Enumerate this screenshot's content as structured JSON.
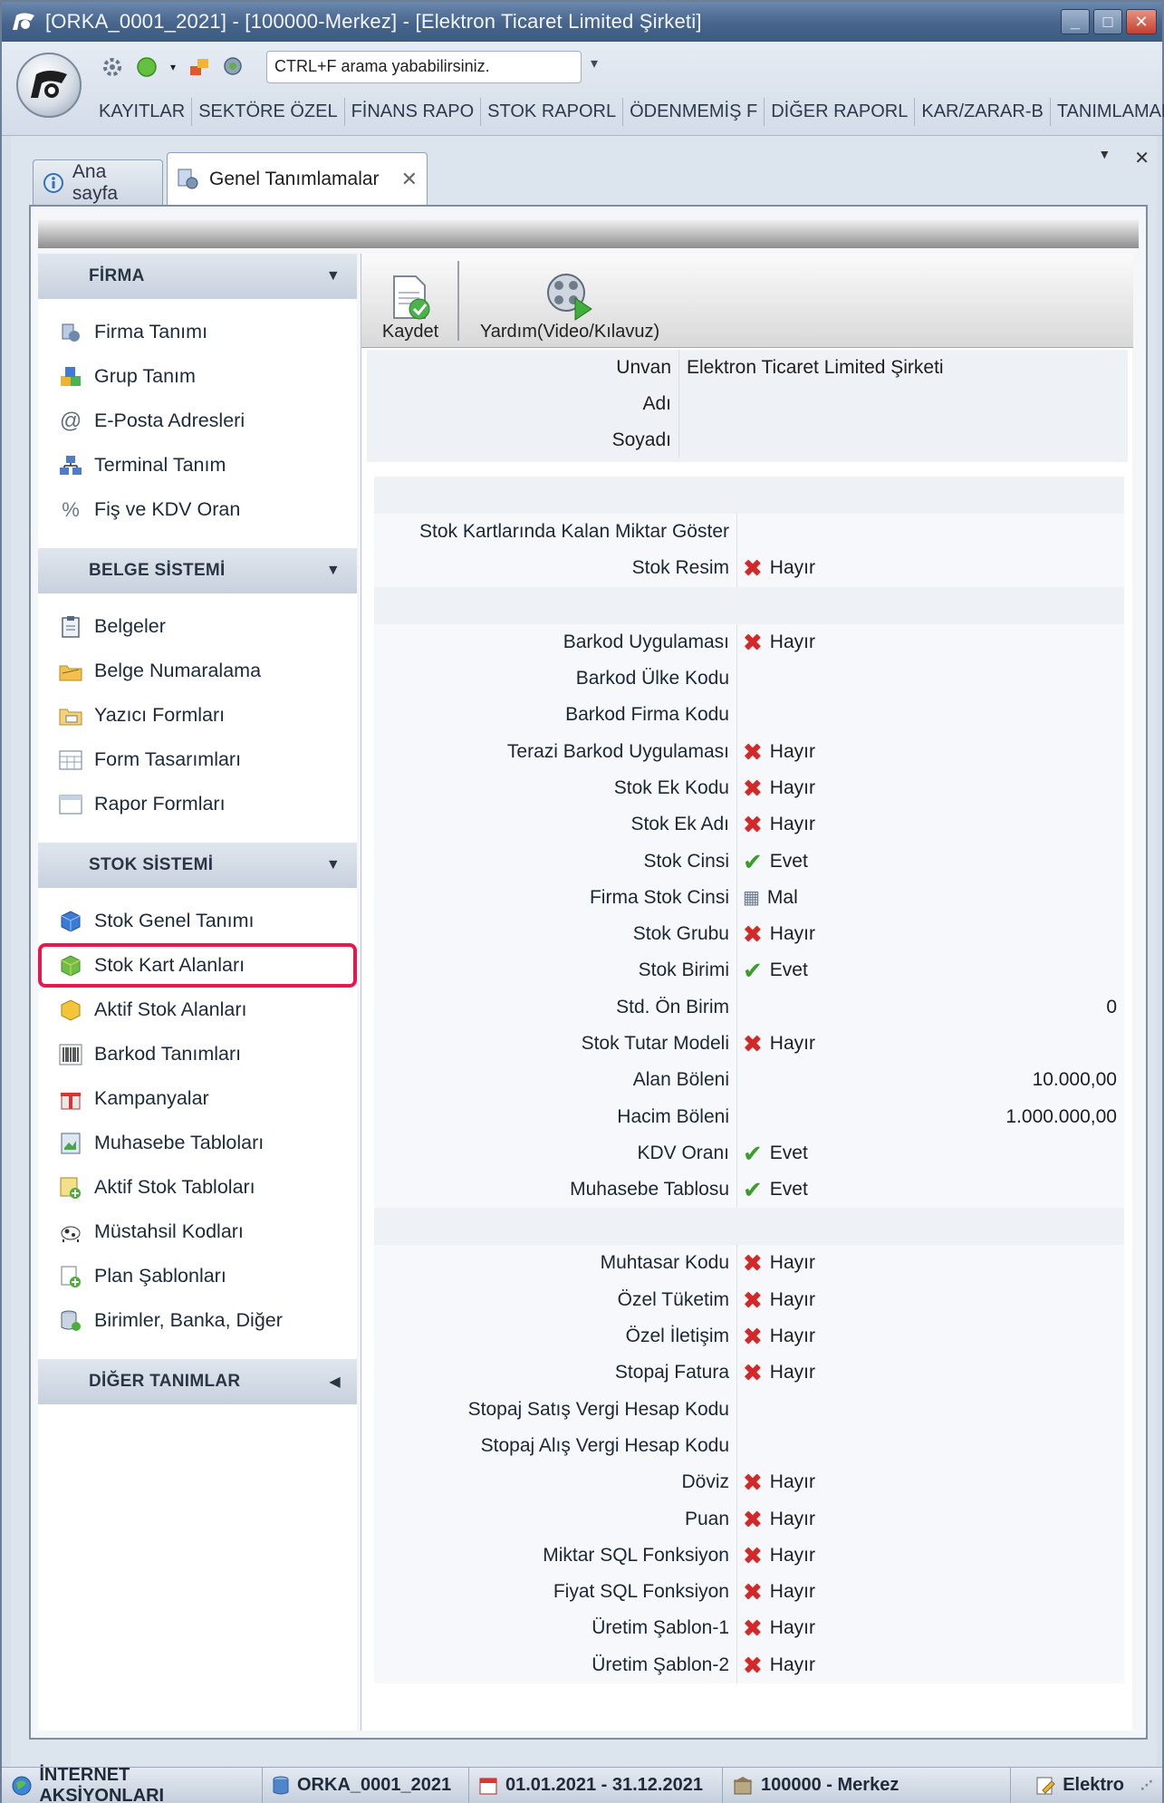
{
  "window": {
    "title": "[ORKA_0001_2021]  -  [100000-Merkez]  -  [Elektron Ticaret Limited Şirketi]",
    "min_glyph": "_",
    "max_glyph": "□",
    "close_glyph": "✕"
  },
  "ribbon": {
    "search_text": "CTRL+F arama yababilirsiniz.",
    "qat_more": "▾",
    "menu": [
      "KAYITLAR",
      "SEKTÖRE ÖZEL",
      "FİNANS RAPO",
      "STOK RAPORL",
      "ÖDENMEMİŞ F",
      "DİĞER RAPORL",
      "KAR/ZARAR-B",
      "TANIMLAMAL"
    ]
  },
  "tabs": {
    "home": "Ana sayfa",
    "active": "Genel Tanımlamalar",
    "close": "✕",
    "dropdown": "▼",
    "close_all": "✕"
  },
  "sidebar": {
    "groups": [
      {
        "title": "FİRMA",
        "arrow": "▼",
        "items": [
          "Firma Tanımı",
          "Grup Tanım",
          "E-Posta Adresleri",
          "Terminal Tanım",
          "Fiş ve KDV Oran"
        ]
      },
      {
        "title": "BELGE SİSTEMİ",
        "arrow": "▼",
        "items": [
          "Belgeler",
          "Belge Numaralama",
          "Yazıcı Formları",
          "Form Tasarımları",
          "Rapor Formları"
        ]
      },
      {
        "title": "STOK SİSTEMİ",
        "arrow": "▼",
        "items": [
          "Stok Genel Tanımı",
          "Stok Kart Alanları",
          "Aktif Stok Alanları",
          "Barkod Tanımları",
          "Kampanyalar",
          "Muhasebe Tabloları",
          "Aktif Stok Tabloları",
          "Müstahsil Kodları",
          "Plan Şablonları",
          "Birimler, Banka, Diğer"
        ]
      },
      {
        "title": "DİĞER TANIMLAR",
        "arrow": "◀",
        "items": []
      }
    ]
  },
  "toolbar": {
    "save": "Kaydet",
    "help": "Yardım(Video/Kılavuz)"
  },
  "company": {
    "unvan_label": "Unvan",
    "unvan_value": "Elektron Ticaret Limited Şirketi",
    "adi_label": "Adı",
    "soyadi_label": "Soyadı"
  },
  "properties": {
    "group1": [
      {
        "label": "Stok Kartlarında Kalan Miktar Göster",
        "mark": "",
        "value": ""
      },
      {
        "label": "Stok Resim",
        "mark": "x",
        "value": "Hayır"
      }
    ],
    "group2": [
      {
        "label": "Barkod Uygulaması",
        "mark": "x",
        "value": "Hayır"
      },
      {
        "label": "Barkod Ülke Kodu",
        "mark": "",
        "value": ""
      },
      {
        "label": "Barkod Firma Kodu",
        "mark": "",
        "value": ""
      },
      {
        "label": "Terazi Barkod Uygulaması",
        "mark": "x",
        "value": "Hayır"
      },
      {
        "label": "Stok Ek Kodu",
        "mark": "x",
        "value": "Hayır"
      },
      {
        "label": "Stok Ek Adı",
        "mark": "x",
        "value": "Hayır"
      },
      {
        "label": "Stok Cinsi",
        "mark": "v",
        "value": "Evet"
      },
      {
        "label": "Firma Stok Cinsi",
        "mark": "box",
        "value": "Mal"
      },
      {
        "label": "Stok Grubu",
        "mark": "x",
        "value": "Hayır"
      },
      {
        "label": "Stok Birimi",
        "mark": "v",
        "value": "Evet"
      },
      {
        "label": "Std. Ön Birim",
        "mark": "num",
        "value": "0"
      },
      {
        "label": "Stok Tutar Modeli",
        "mark": "x",
        "value": "Hayır"
      },
      {
        "label": "Alan Böleni",
        "mark": "num",
        "value": "10.000,00"
      },
      {
        "label": "Hacim Böleni",
        "mark": "num",
        "value": "1.000.000,00"
      },
      {
        "label": "KDV Oranı",
        "mark": "v",
        "value": "Evet"
      },
      {
        "label": "Muhasebe Tablosu",
        "mark": "v",
        "value": "Evet"
      }
    ],
    "group3": [
      {
        "label": "Muhtasar Kodu",
        "mark": "x",
        "value": "Hayır"
      },
      {
        "label": "Özel Tüketim",
        "mark": "x",
        "value": "Hayır"
      },
      {
        "label": "Özel İletişim",
        "mark": "x",
        "value": "Hayır"
      },
      {
        "label": "Stopaj Fatura",
        "mark": "x",
        "value": "Hayır"
      },
      {
        "label": "Stopaj Satış Vergi Hesap Kodu",
        "mark": "",
        "value": ""
      },
      {
        "label": "Stopaj Alış Vergi Hesap Kodu",
        "mark": "",
        "value": ""
      },
      {
        "label": "Döviz",
        "mark": "x",
        "value": "Hayır"
      },
      {
        "label": "Puan",
        "mark": "x",
        "value": "Hayır"
      },
      {
        "label": "Miktar SQL Fonksiyon",
        "mark": "x",
        "value": "Hayır"
      },
      {
        "label": "Fiyat SQL Fonksiyon",
        "mark": "x",
        "value": "Hayır"
      },
      {
        "label": "Üretim Şablon-1",
        "mark": "x",
        "value": "Hayır"
      },
      {
        "label": "Üretim Şablon-2",
        "mark": "x",
        "value": "Hayır"
      }
    ]
  },
  "statusbar": {
    "internet": "İNTERNET AKSİYONLARI",
    "db": "ORKA_0001_2021",
    "period": "01.01.2021 - 31.12.2021",
    "branch": "100000 - Merkez",
    "company_short": "Elektro"
  }
}
